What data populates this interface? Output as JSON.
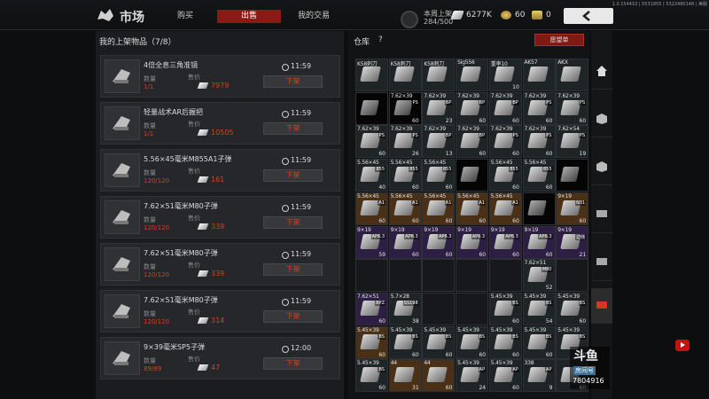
{
  "header": {
    "title": "市场",
    "tabs": [
      {
        "label": "购买",
        "active": false
      },
      {
        "label": "出售",
        "active": true
      },
      {
        "label": "我的交易",
        "active": false
      }
    ],
    "slot_label": "本周上架",
    "slot_value": "284/500",
    "currency_money": "6277K",
    "currency_gold": "60",
    "currency_coin": "0",
    "version": "1.0.154410 | 0531855 | 5322480148 | 美服"
  },
  "listings": {
    "title": "我的上架物品（7/8）",
    "quantity_label": "数量",
    "price_label": "售价",
    "delist_label": "下架",
    "items": [
      {
        "name": "4倍全息三角准镜",
        "qty": "1/1",
        "price": "7979",
        "time": "11:59",
        "icon": "scope-icon"
      },
      {
        "name": "轻量战术AR后握把",
        "qty": "1/1",
        "price": "10505",
        "time": "11:59",
        "icon": "grip-icon"
      },
      {
        "name": "5.56×45毫米M855A1子弹",
        "qty": "120/120",
        "price": "161",
        "time": "11:59",
        "icon": "ammo-icon"
      },
      {
        "name": "7.62×51毫米M80子弹",
        "qty": "120/120",
        "price": "339",
        "time": "11:59",
        "icon": "ammo-icon"
      },
      {
        "name": "7.62×51毫米M80子弹",
        "qty": "120/120",
        "price": "339",
        "time": "11:59",
        "icon": "ammo-icon"
      },
      {
        "name": "7.62×51毫米M80子弹",
        "qty": "120/120",
        "price": "314",
        "time": "11:59",
        "icon": "ammo-icon"
      },
      {
        "name": "9×39毫米SP5子弹",
        "qty": "89/89",
        "price": "47",
        "time": "12:00",
        "icon": "ammo-icon"
      }
    ]
  },
  "warehouse": {
    "title": "仓库",
    "help": "?",
    "wishlist_label": "愿望单",
    "rows": [
      [
        {
          "label": "K58刺刀",
          "tag": "",
          "count": "",
          "color": "dark"
        },
        {
          "label": "K58刺刀",
          "tag": "",
          "count": "",
          "color": "dark"
        },
        {
          "label": "K58刺刀",
          "tag": "",
          "count": "",
          "color": "dark"
        },
        {
          "label": "Sig556",
          "tag": "",
          "count": "",
          "color": "dark"
        },
        {
          "label": "重率10",
          "tag": "",
          "count": "10",
          "color": "dark"
        },
        {
          "label": "AK57",
          "tag": "",
          "count": "",
          "color": "dark"
        },
        {
          "label": "AKX",
          "tag": "",
          "count": "",
          "color": "dark"
        }
      ],
      [
        {
          "label": "",
          "tag": "",
          "count": "",
          "color": "black"
        },
        {
          "label": "7.62×39",
          "tag": "PS",
          "count": "60",
          "color": "black"
        },
        {
          "label": "7.62×39",
          "tag": "BP",
          "count": "23",
          "color": "dark"
        },
        {
          "label": "7.62×39",
          "tag": "BP",
          "count": "60",
          "color": "dark"
        },
        {
          "label": "7.62×39",
          "tag": "BP",
          "count": "60",
          "color": "dark"
        },
        {
          "label": "7.62×39",
          "tag": "PS",
          "count": "60",
          "color": "dark"
        },
        {
          "label": "7.62×39",
          "tag": "PS",
          "count": "60",
          "color": "dark"
        }
      ],
      [
        {
          "label": "7.62×39",
          "tag": "PS",
          "count": "60",
          "color": "dark"
        },
        {
          "label": "7.62×39",
          "tag": "PS",
          "count": "26",
          "color": "dark"
        },
        {
          "label": "7.62×39",
          "tag": "BP",
          "count": "13",
          "color": "dark"
        },
        {
          "label": "7.62×39",
          "tag": "BP",
          "count": "60",
          "color": "dark"
        },
        {
          "label": "7.62×39",
          "tag": "PS",
          "count": "60",
          "color": "dark"
        },
        {
          "label": "7.62×39",
          "tag": "PS",
          "count": "60",
          "color": "dark"
        },
        {
          "label": "7.62×54",
          "tag": "PS",
          "count": "19",
          "color": "dark"
        }
      ],
      [
        {
          "label": "5.56×45",
          "tag": "855",
          "count": "40",
          "color": "dark"
        },
        {
          "label": "5.56×45",
          "tag": "855",
          "count": "60",
          "color": "dark"
        },
        {
          "label": "5.56×45",
          "tag": "855",
          "count": "60",
          "color": "dark"
        },
        {
          "label": "",
          "tag": "",
          "count": "",
          "color": "black"
        },
        {
          "label": "5.56×45",
          "tag": "855",
          "count": "60",
          "color": "dark"
        },
        {
          "label": "5.56×45",
          "tag": "855",
          "count": "60",
          "color": "dark"
        },
        {
          "label": "",
          "tag": "",
          "count": "",
          "color": "black"
        }
      ],
      [
        {
          "label": "5.56×45",
          "tag": "A1",
          "count": "60",
          "color": "orange"
        },
        {
          "label": "5.56×45",
          "tag": "A1",
          "count": "60",
          "color": "orange"
        },
        {
          "label": "5.56×45",
          "tag": "A1",
          "count": "60",
          "color": "orange"
        },
        {
          "label": "5.56×45",
          "tag": "A1",
          "count": "60",
          "color": "orange"
        },
        {
          "label": "5.56×45",
          "tag": "A1",
          "count": "60",
          "color": "orange"
        },
        {
          "label": "",
          "tag": "",
          "count": "",
          "color": "black"
        },
        {
          "label": "9×19",
          "tag": "N31",
          "count": "60",
          "color": "orange"
        }
      ],
      [
        {
          "label": "9×19",
          "tag": "AP6.3",
          "count": "59",
          "color": "purple"
        },
        {
          "label": "9×19",
          "tag": "AP6.3",
          "count": "60",
          "color": "purple"
        },
        {
          "label": "9×19",
          "tag": "AP6.3",
          "count": "60",
          "color": "purple"
        },
        {
          "label": "9×19",
          "tag": "AP6.3",
          "count": "60",
          "color": "purple"
        },
        {
          "label": "9×19",
          "tag": "AP6.3",
          "count": "60",
          "color": "purple"
        },
        {
          "label": "9×19",
          "tag": "AP6.3",
          "count": "60",
          "color": "purple"
        },
        {
          "label": "9×19",
          "tag": "边侧",
          "count": "21",
          "color": "purple"
        }
      ],
      [
        {
          "label": "",
          "tag": "",
          "count": "",
          "color": "empty"
        },
        {
          "label": "",
          "tag": "",
          "count": "",
          "color": "empty"
        },
        {
          "label": "",
          "tag": "",
          "count": "",
          "color": "empty"
        },
        {
          "label": "",
          "tag": "",
          "count": "",
          "color": "empty"
        },
        {
          "label": "",
          "tag": "",
          "count": "",
          "color": "empty"
        },
        {
          "label": "7.62×51",
          "tag": "M80",
          "count": "52",
          "color": "dark"
        },
        {
          "label": "",
          "tag": "",
          "count": "",
          "color": "empty"
        }
      ],
      [
        {
          "label": "7.62×51",
          "tag": "BPZ",
          "count": "60",
          "color": "purple"
        },
        {
          "label": "5.7×28",
          "tag": "SS198",
          "count": "38",
          "color": "dark"
        },
        {
          "label": "",
          "tag": "",
          "count": "",
          "color": "empty"
        },
        {
          "label": "",
          "tag": "",
          "count": "",
          "color": "empty"
        },
        {
          "label": "5.45×39",
          "tag": "BS",
          "count": "60",
          "color": "dark"
        },
        {
          "label": "5.45×39",
          "tag": "BS",
          "count": "54",
          "color": "dark"
        },
        {
          "label": "5.45×39",
          "tag": "BS",
          "count": "60",
          "color": "dark"
        }
      ],
      [
        {
          "label": "5.45×39",
          "tag": "BS",
          "count": "60",
          "color": "orange"
        },
        {
          "label": "5.45×39",
          "tag": "BS",
          "count": "60",
          "color": "dark"
        },
        {
          "label": "5.45×39",
          "tag": "BS",
          "count": "60",
          "color": "dark"
        },
        {
          "label": "5.45×39",
          "tag": "BS",
          "count": "60",
          "color": "dark"
        },
        {
          "label": "5.45×39",
          "tag": "BS",
          "count": "60",
          "color": "dark"
        },
        {
          "label": "5.45×39",
          "tag": "BS",
          "count": "60",
          "color": "dark"
        },
        {
          "label": "5.45×39",
          "tag": "BS",
          "count": "60",
          "color": "dark"
        }
      ],
      [
        {
          "label": "5.45×39",
          "tag": "BS",
          "count": "60",
          "color": "dark"
        },
        {
          "label": "44",
          "tag": "",
          "count": "31",
          "color": "orange"
        },
        {
          "label": "44",
          "tag": "",
          "count": "60",
          "color": "orange"
        },
        {
          "label": "5.45×39",
          "tag": "AP",
          "count": "24",
          "color": "dark"
        },
        {
          "label": "5.45×39",
          "tag": "AP",
          "count": "60",
          "color": "dark"
        },
        {
          "label": "338",
          "tag": "AP",
          "count": "9",
          "color": "dark"
        },
        {
          "label": "",
          "tag": "",
          "count": "60",
          "color": "dark"
        }
      ]
    ]
  },
  "watermark": {
    "logo": "斗鱼",
    "label": "房间号",
    "room": "7804916"
  }
}
